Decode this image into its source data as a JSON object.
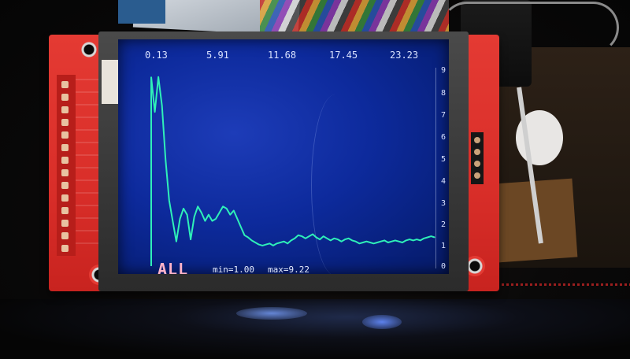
{
  "display": {
    "x_labels": [
      "0.13",
      "5.91",
      "11.68",
      "17.45",
      "23.23"
    ],
    "y_labels": [
      "9",
      "8",
      "7",
      "6",
      "5",
      "4",
      "3",
      "2",
      "1",
      "0"
    ],
    "mode_label": "ALL",
    "min_label": "min=1.00",
    "max_label": "max=9.22",
    "trace_color": "#2ff0b8"
  },
  "chart_data": {
    "type": "line",
    "x": [
      0,
      1,
      2,
      3,
      4,
      5,
      6,
      7,
      8,
      9,
      10,
      11,
      12,
      13,
      14,
      15,
      16,
      17,
      18,
      19,
      20,
      21,
      22,
      23,
      24,
      25,
      26,
      27,
      28,
      29,
      30,
      31,
      32,
      33,
      34,
      35,
      36,
      37,
      38,
      39,
      40,
      41,
      42,
      43,
      44,
      45,
      46,
      47,
      48,
      49,
      50,
      51,
      52,
      53,
      54,
      55,
      56,
      57,
      58,
      59,
      60,
      61,
      62,
      63,
      64,
      65,
      66,
      67,
      68,
      69,
      70,
      71,
      72,
      73,
      74,
      75,
      76,
      77,
      78,
      79
    ],
    "values": [
      9.2,
      7.5,
      9.2,
      7.8,
      5.2,
      3.2,
      2.2,
      1.2,
      2.3,
      2.8,
      2.5,
      1.3,
      2.4,
      2.9,
      2.6,
      2.2,
      2.5,
      2.2,
      2.3,
      2.6,
      2.9,
      2.8,
      2.5,
      2.7,
      2.3,
      1.9,
      1.5,
      1.4,
      1.25,
      1.15,
      1.05,
      1.0,
      1.05,
      1.1,
      1.0,
      1.1,
      1.15,
      1.2,
      1.1,
      1.25,
      1.35,
      1.5,
      1.45,
      1.35,
      1.45,
      1.55,
      1.4,
      1.3,
      1.45,
      1.35,
      1.25,
      1.35,
      1.3,
      1.2,
      1.3,
      1.35,
      1.25,
      1.2,
      1.1,
      1.15,
      1.2,
      1.15,
      1.1,
      1.15,
      1.2,
      1.25,
      1.15,
      1.2,
      1.25,
      1.2,
      1.15,
      1.25,
      1.3,
      1.25,
      1.3,
      1.25,
      1.35,
      1.4,
      1.45,
      1.4
    ],
    "xlim": [
      0.13,
      29.0
    ],
    "ylim": [
      0,
      9.5
    ],
    "grid": false
  }
}
